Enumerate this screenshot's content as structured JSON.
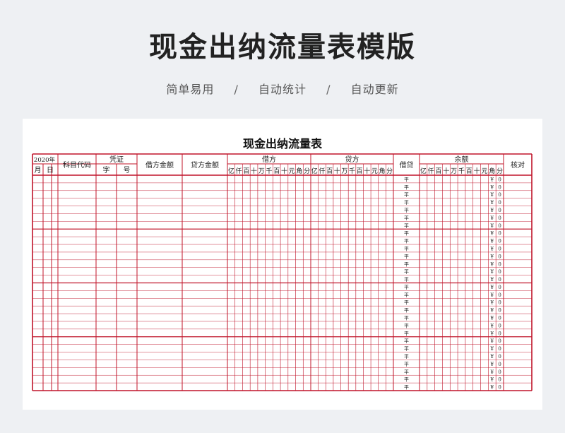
{
  "page": {
    "title": "现金出纳流量表模版",
    "features": [
      "简单易用",
      "自动统计",
      "自动更新"
    ],
    "separator": "/"
  },
  "sheet": {
    "title": "现金出纳流量表",
    "year_label": "2020年",
    "month_label": "月",
    "day_label": "日",
    "account_code_label": "科目代码",
    "voucher_label": "凭证",
    "voucher_char_label": "字",
    "voucher_no_label": "号",
    "debit_amount_label": "借方金额",
    "credit_amount_label": "贷方金额",
    "debit_label": "借方",
    "credit_label": "贷方",
    "dc_label": "借贷",
    "balance_label": "余额",
    "check_label": "核对",
    "digits": [
      "亿",
      "仟",
      "百",
      "十",
      "万",
      "千",
      "百",
      "十",
      "元",
      "角",
      "分"
    ],
    "balance_digits": [
      "亿",
      "仟",
      "百",
      "十",
      "万",
      "千",
      "百",
      "十",
      "元",
      "角",
      "分"
    ],
    "flat_mark": "平",
    "currency_mark": "¥",
    "zero_mark": "0",
    "row_count": 28
  },
  "colors": {
    "grid_red": "#c0142a",
    "page_bg": "#eef0f3",
    "title": "#222222"
  }
}
